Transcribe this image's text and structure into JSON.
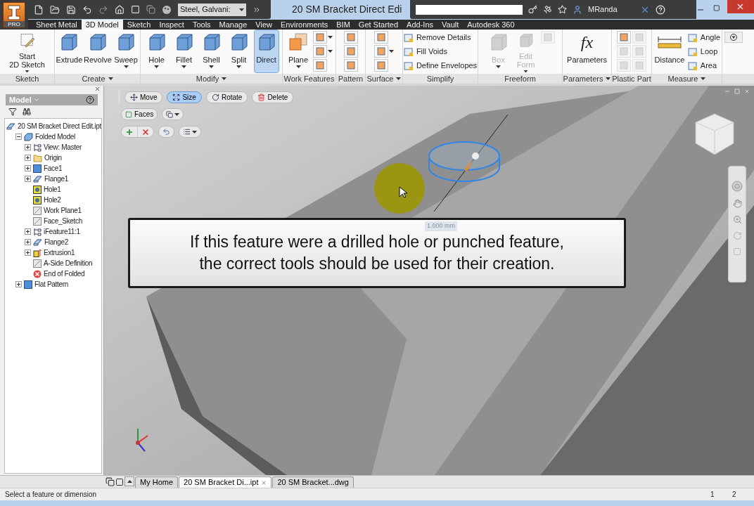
{
  "app_button": {
    "badge": "PRO"
  },
  "quick_access": {
    "material": "Steel, Galvani:"
  },
  "window": {
    "title": "20 SM Bracket Direct Edi"
  },
  "infocenter": {
    "user": "MRanda"
  },
  "ribbon_tabs": [
    {
      "label": "Sheet Metal",
      "selected": false
    },
    {
      "label": "3D Model",
      "selected": true
    },
    {
      "label": "Sketch",
      "selected": false
    },
    {
      "label": "Inspect",
      "selected": false
    },
    {
      "label": "Tools",
      "selected": false
    },
    {
      "label": "Manage",
      "selected": false
    },
    {
      "label": "View",
      "selected": false
    },
    {
      "label": "Environments",
      "selected": false
    },
    {
      "label": "BIM",
      "selected": false
    },
    {
      "label": "Get Started",
      "selected": false
    },
    {
      "label": "Add-Ins",
      "selected": false
    },
    {
      "label": "Vault",
      "selected": false
    },
    {
      "label": "Autodesk 360",
      "selected": false
    }
  ],
  "ribbon_panels": [
    {
      "label": "Sketch",
      "menu": false,
      "items": [
        {
          "kind": "large",
          "label": "Start\n2D Sketch",
          "menu": true,
          "disabled": false,
          "selected": false
        }
      ]
    },
    {
      "label": "Create",
      "menu": true,
      "items": [
        {
          "kind": "large",
          "label": "Extrude",
          "menu": false,
          "disabled": false,
          "selected": false
        },
        {
          "kind": "large",
          "label": "Revolve",
          "menu": false,
          "disabled": false,
          "selected": false
        },
        {
          "kind": "large",
          "label": "Sweep",
          "menu": true,
          "disabled": false,
          "selected": false
        }
      ]
    },
    {
      "label": "Modify",
      "menu": true,
      "items": [
        {
          "kind": "large",
          "label": "Hole",
          "menu": true,
          "disabled": false,
          "selected": false
        },
        {
          "kind": "large",
          "label": "Fillet",
          "menu": true,
          "disabled": false,
          "selected": false
        },
        {
          "kind": "large",
          "label": "Shell",
          "menu": true,
          "disabled": false,
          "selected": false
        },
        {
          "kind": "large",
          "label": "Split",
          "menu": true,
          "disabled": false,
          "selected": false
        },
        {
          "kind": "large",
          "label": "Direct",
          "menu": false,
          "disabled": false,
          "selected": true
        }
      ]
    },
    {
      "label": "Work Features",
      "menu": false,
      "items": [
        {
          "kind": "large",
          "label": "Plane",
          "menu": true,
          "disabled": false,
          "selected": false
        },
        {
          "kind": "stack",
          "icons": [
            {
              "menu": true,
              "disabled": false
            },
            {
              "menu": true,
              "disabled": false
            },
            {
              "menu": false,
              "disabled": false
            }
          ]
        }
      ]
    },
    {
      "label": "Pattern",
      "menu": false,
      "items": [
        {
          "kind": "stack",
          "icons": [
            {
              "menu": false,
              "disabled": false
            },
            {
              "menu": false,
              "disabled": false
            },
            {
              "menu": false,
              "disabled": false
            }
          ]
        }
      ]
    },
    {
      "label": "Surface",
      "menu": true,
      "items": [
        {
          "kind": "stack",
          "icons": [
            {
              "menu": false,
              "disabled": false
            },
            {
              "menu": true,
              "disabled": false
            },
            {
              "menu": false,
              "disabled": false
            }
          ]
        }
      ]
    },
    {
      "label": "Simplify",
      "menu": false,
      "items": [
        {
          "kind": "rows",
          "rows": [
            {
              "label": "Remove Details",
              "disabled": false
            },
            {
              "label": "Fill Voids",
              "disabled": false
            },
            {
              "label": "Define Envelopes",
              "disabled": false
            }
          ]
        }
      ]
    },
    {
      "label": "Freeform",
      "menu": false,
      "items": [
        {
          "kind": "large",
          "label": "Box",
          "menu": true,
          "disabled": true,
          "selected": false
        },
        {
          "kind": "large",
          "label": "Edit\nForm",
          "menu": true,
          "disabled": true,
          "selected": false
        },
        {
          "kind": "stack",
          "icons": [
            {
              "menu": false,
              "disabled": true
            }
          ]
        }
      ]
    },
    {
      "label": "Parameters",
      "menu": true,
      "items": [
        {
          "kind": "large",
          "label": "Parameters",
          "glyph": "fx",
          "menu": false,
          "disabled": false,
          "selected": false
        }
      ]
    },
    {
      "label": "Plastic Part",
      "menu": false,
      "items": [
        {
          "kind": "grid",
          "icons": [
            {
              "menu": false,
              "disabled": false
            },
            {
              "menu": false,
              "disabled": true
            },
            {
              "menu": false,
              "disabled": true
            },
            {
              "menu": false,
              "disabled": true
            },
            {
              "menu": false,
              "disabled": true
            },
            {
              "menu": false,
              "disabled": true
            }
          ]
        }
      ]
    },
    {
      "label": "Measure",
      "menu": true,
      "items": [
        {
          "kind": "large",
          "label": "Distance",
          "menu": false,
          "disabled": false,
          "selected": false
        },
        {
          "kind": "rows",
          "rows": [
            {
              "label": "Angle",
              "disabled": false
            },
            {
              "label": "Loop",
              "disabled": false
            },
            {
              "label": "Area",
              "disabled": false
            }
          ]
        }
      ]
    }
  ],
  "browser": {
    "title": "Model",
    "tree": [
      {
        "label": "20 SM Bracket Direct Edit.ipt",
        "kind": "part",
        "children": [
          {
            "label": "Folded Model",
            "kind": "assembly",
            "expanded": true,
            "children": [
              {
                "label": "View: Master",
                "kind": "view",
                "expanded": false
              },
              {
                "label": "Origin",
                "kind": "folder",
                "expanded": false
              },
              {
                "label": "Face1",
                "kind": "face",
                "expanded": false
              },
              {
                "label": "Flange1",
                "kind": "part",
                "expanded": false
              },
              {
                "label": "Hole1",
                "kind": "hole"
              },
              {
                "label": "Hole2",
                "kind": "hole"
              },
              {
                "label": "Work Plane1",
                "kind": "sketch"
              },
              {
                "label": "Face_Sketch",
                "kind": "sketch"
              },
              {
                "label": "iFeature11:1",
                "kind": "view",
                "expanded": false
              },
              {
                "label": "Flange2",
                "kind": "part",
                "expanded": false
              },
              {
                "label": "Extrusion1",
                "kind": "extrusion",
                "expanded": false
              },
              {
                "label": "A-Side Definition",
                "kind": "sketch"
              },
              {
                "label": "End of Folded",
                "kind": "stop"
              }
            ]
          },
          {
            "label": "Flat Pattern",
            "kind": "face",
            "expanded": false
          }
        ]
      }
    ]
  },
  "direct_edit": {
    "modes": [
      {
        "label": "Move",
        "selected": false
      },
      {
        "label": "Size",
        "selected": true
      },
      {
        "label": "Rotate",
        "selected": false
      },
      {
        "label": "Delete",
        "selected": false
      }
    ],
    "selection": {
      "label": "Faces"
    }
  },
  "dimension": {
    "value": "1.000 mm"
  },
  "callout": {
    "text": "If this feature were a drilled hole or punched feature,\nthe correct tools should be used for their creation."
  },
  "document_tabs": [
    {
      "label": "My Home",
      "selected": false,
      "closable": false
    },
    {
      "label": "20 SM Bracket Di...ipt",
      "selected": true,
      "closable": true
    },
    {
      "label": "20 SM Bracket...dwg",
      "selected": false,
      "closable": false
    }
  ],
  "status_bar": {
    "message": "Select a feature or dimension",
    "fields": [
      "1",
      "2"
    ]
  }
}
